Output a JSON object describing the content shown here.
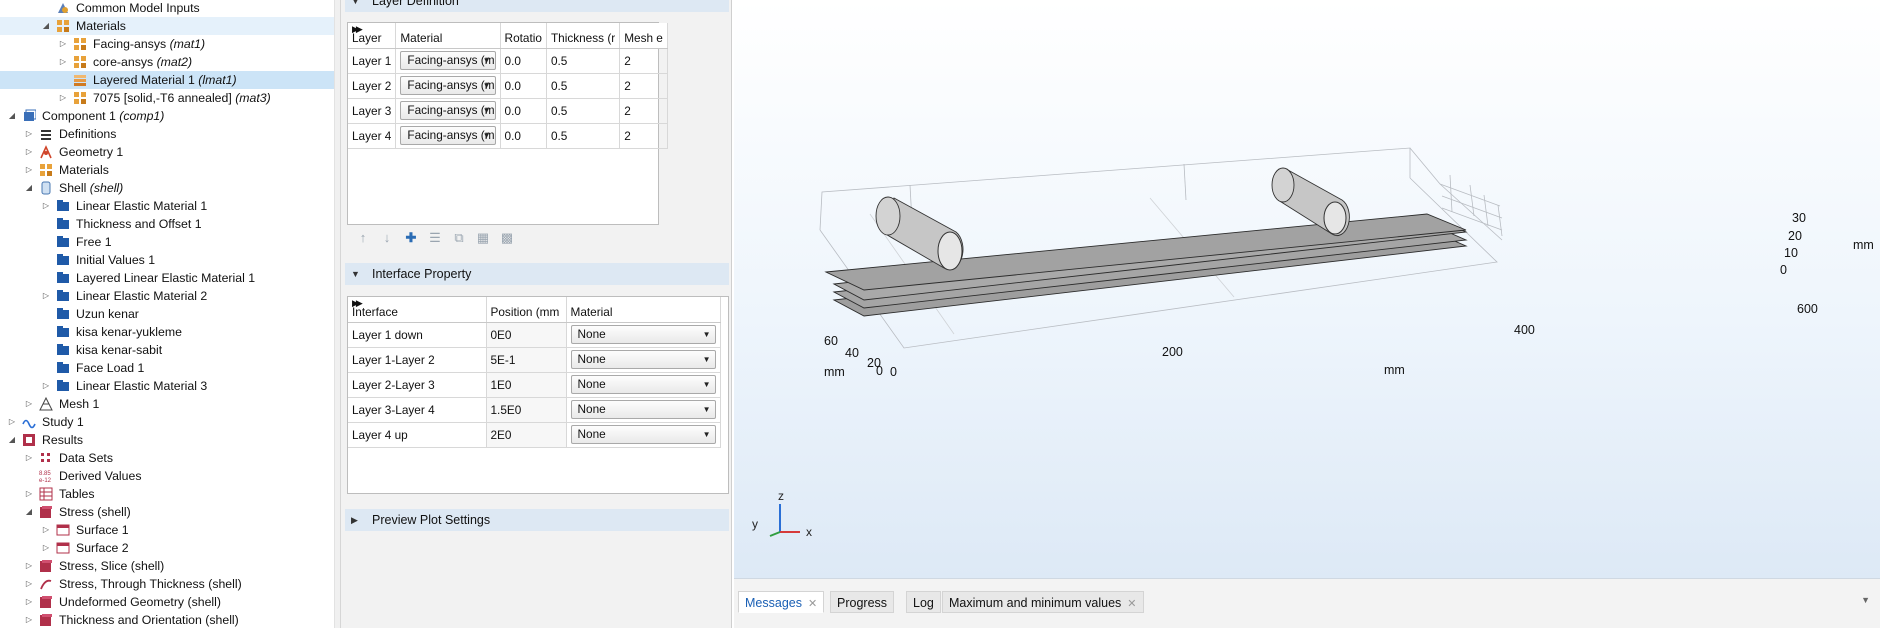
{
  "tree": {
    "rows": [
      {
        "label": "Common Model Inputs",
        "tag": ""
      },
      {
        "label": "Materials",
        "tag": ""
      },
      {
        "label": "Facing-ansys",
        "tag": "(mat1)"
      },
      {
        "label": "core-ansys",
        "tag": "(mat2)"
      },
      {
        "label": "Layered Material 1",
        "tag": "(lmat1)"
      },
      {
        "label": "7075 [solid,-T6 annealed]",
        "tag": "(mat3)"
      },
      {
        "label": "Component 1",
        "tag": "(comp1)"
      },
      {
        "label": "Definitions",
        "tag": ""
      },
      {
        "label": "Geometry 1",
        "tag": ""
      },
      {
        "label": "Materials",
        "tag": ""
      },
      {
        "label": "Shell",
        "tag": "(shell)"
      },
      {
        "label": "Linear Elastic Material 1",
        "tag": ""
      },
      {
        "label": "Thickness and Offset 1",
        "tag": ""
      },
      {
        "label": "Free 1",
        "tag": ""
      },
      {
        "label": "Initial Values 1",
        "tag": ""
      },
      {
        "label": "Layered Linear Elastic Material 1",
        "tag": ""
      },
      {
        "label": "Linear Elastic Material 2",
        "tag": ""
      },
      {
        "label": "Uzun kenar",
        "tag": ""
      },
      {
        "label": "kisa kenar-yukleme",
        "tag": ""
      },
      {
        "label": "kisa kenar-sabit",
        "tag": ""
      },
      {
        "label": "Face Load 1",
        "tag": ""
      },
      {
        "label": "Linear Elastic Material 3",
        "tag": ""
      },
      {
        "label": "Mesh 1",
        "tag": ""
      },
      {
        "label": "Study 1",
        "tag": ""
      },
      {
        "label": "Results",
        "tag": ""
      },
      {
        "label": "Data Sets",
        "tag": ""
      },
      {
        "label": "Derived Values",
        "tag": ""
      },
      {
        "label": "Tables",
        "tag": ""
      },
      {
        "label": "Stress (shell)",
        "tag": ""
      },
      {
        "label": "Surface 1",
        "tag": ""
      },
      {
        "label": "Surface 2",
        "tag": ""
      },
      {
        "label": "Stress, Slice (shell)",
        "tag": ""
      },
      {
        "label": "Stress, Through Thickness (shell)",
        "tag": ""
      },
      {
        "label": "Undeformed Geometry (shell)",
        "tag": ""
      },
      {
        "label": "Thickness and Orientation (shell)",
        "tag": ""
      }
    ]
  },
  "layer_definition": {
    "title": "Layer Definition",
    "headers": [
      "Layer",
      "Material",
      "Rotatio",
      "Thickness (r",
      "Mesh e"
    ],
    "rows": [
      {
        "layer": "Layer 1",
        "material": "Facing-ansys (m",
        "rotation": "0.0",
        "thickness": "0.5",
        "mesh": "2"
      },
      {
        "layer": "Layer 2",
        "material": "Facing-ansys (m",
        "rotation": "0.0",
        "thickness": "0.5",
        "mesh": "2"
      },
      {
        "layer": "Layer 3",
        "material": "Facing-ansys (m",
        "rotation": "0.0",
        "thickness": "0.5",
        "mesh": "2"
      },
      {
        "layer": "Layer 4",
        "material": "Facing-ansys (m",
        "rotation": "0.0",
        "thickness": "0.5",
        "mesh": "2"
      }
    ]
  },
  "interface_property": {
    "title": "Interface Property",
    "headers": [
      "Interface",
      "Position (mm",
      "Material"
    ],
    "rows": [
      {
        "interface": "Layer 1 down",
        "position": "0E0",
        "material": "None"
      },
      {
        "interface": "Layer 1-Layer 2",
        "position": "5E-1",
        "material": "None"
      },
      {
        "interface": "Layer 2-Layer 3",
        "position": "1E0",
        "material": "None"
      },
      {
        "interface": "Layer 3-Layer 4",
        "position": "1.5E0",
        "material": "None"
      },
      {
        "interface": "Layer 4 up",
        "position": "2E0",
        "material": "None"
      }
    ]
  },
  "preview_plot": {
    "title": "Preview Plot Settings"
  },
  "graphics": {
    "x_ticks": [
      "0",
      "200",
      "400",
      "600"
    ],
    "x_unit": "mm",
    "y_ticks": [
      "60",
      "40",
      "20",
      "0"
    ],
    "y_unit": "mm",
    "z_ticks": [
      "30",
      "20",
      "10",
      "0"
    ],
    "z_unit": "mm",
    "triad": {
      "x": "x",
      "y": "y",
      "z": "z"
    }
  },
  "messages": {
    "tabs": [
      "Messages",
      "Progress",
      "Log",
      "Maximum and minimum values"
    ]
  },
  "colors": {
    "selection": "#cce4f7",
    "section_header": "#dde8f3",
    "accent": "#1a5fb4"
  }
}
